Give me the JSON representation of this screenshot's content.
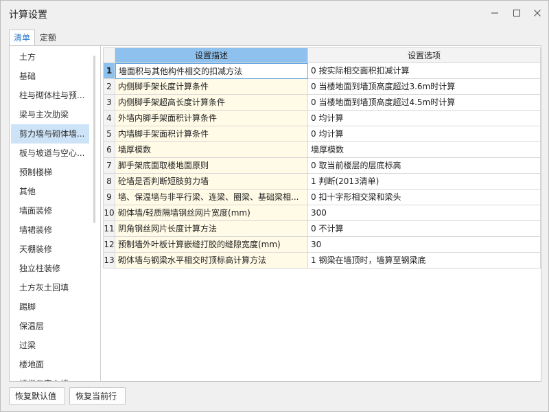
{
  "window": {
    "title": "计算设置",
    "min_icon": "minimize-icon",
    "max_icon": "maximize-icon",
    "close_icon": "close-icon"
  },
  "tabs": [
    {
      "label": "清单",
      "active": true
    },
    {
      "label": "定额",
      "active": false
    }
  ],
  "sidebar": {
    "selected_index": 4,
    "items": [
      {
        "label": "土方"
      },
      {
        "label": "基础"
      },
      {
        "label": "柱与砌体柱与预..."
      },
      {
        "label": "梁与主次肋梁"
      },
      {
        "label": "剪力墙与砌体墙..."
      },
      {
        "label": "板与坡道与空心..."
      },
      {
        "label": "预制楼梯"
      },
      {
        "label": "其他"
      },
      {
        "label": "墙面装修"
      },
      {
        "label": "墙裙装修"
      },
      {
        "label": "天棚装修"
      },
      {
        "label": "独立柱装修"
      },
      {
        "label": "土方灰土回填"
      },
      {
        "label": "踢脚"
      },
      {
        "label": "保温层"
      },
      {
        "label": "过梁"
      },
      {
        "label": "楼地面"
      },
      {
        "label": "楼梯与空心楼..."
      }
    ]
  },
  "grid": {
    "headers": {
      "desc": "设置描述",
      "option": "设置选项"
    },
    "selected_row": 0,
    "rows": [
      {
        "num": "1",
        "desc": "墙面积与其他构件相交的扣减方法",
        "option": "0 按实际相交面积扣减计算"
      },
      {
        "num": "2",
        "desc": "内侧脚手架长度计算条件",
        "option": "0 当楼地面到墙顶高度超过3.6m时计算"
      },
      {
        "num": "3",
        "desc": "内侧脚手架超高长度计算条件",
        "option": "0 当楼地面到墙顶高度超过4.5m时计算"
      },
      {
        "num": "4",
        "desc": "外墙内脚手架面积计算条件",
        "option": "0 均计算"
      },
      {
        "num": "5",
        "desc": "内墙脚手架面积计算条件",
        "option": "0 均计算"
      },
      {
        "num": "6",
        "desc": "墙厚模数",
        "option": "墙厚模数"
      },
      {
        "num": "7",
        "desc": "脚手架底面取楼地面原则",
        "option": "0 取当前楼层的层底标高"
      },
      {
        "num": "8",
        "desc": "砼墙是否判断短肢剪力墙",
        "option": "1 判断(2013清单)"
      },
      {
        "num": "9",
        "desc": "墙、保温墙与非平行梁、连梁、圈梁、基础梁相...",
        "option": "0 扣十字形相交梁和梁头"
      },
      {
        "num": "10",
        "desc": "砌体墙/轻质隔墙钢丝网片宽度(mm)",
        "option": "300"
      },
      {
        "num": "11",
        "desc": "阴角钢丝网片长度计算方法",
        "option": "0 不计算"
      },
      {
        "num": "12",
        "desc": "预制墙外叶板计算嵌缝打胶的缝隙宽度(mm)",
        "option": "30"
      },
      {
        "num": "13",
        "desc": "砌体墙与钢梁水平相交时顶标高计算方法",
        "option": "1 钢梁在墙顶时，墙算至钢梁底"
      }
    ]
  },
  "footer": {
    "restore_default": "恢复默认值",
    "restore_current": "恢复当前行"
  }
}
